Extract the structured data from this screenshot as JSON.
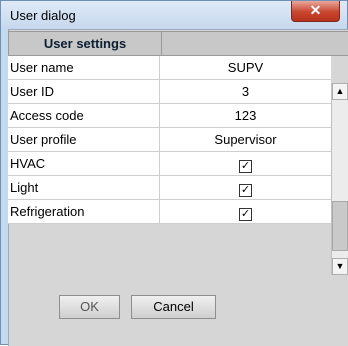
{
  "window": {
    "title": "User dialog",
    "close_icon": "✕"
  },
  "grid": {
    "header": "User settings",
    "rows": [
      {
        "label": "User name",
        "value": "SUPV"
      },
      {
        "label": "User ID",
        "value": "3"
      },
      {
        "label": "Access code",
        "value": "123"
      },
      {
        "label": "User profile",
        "value": "Supervisor"
      },
      {
        "label": "HVAC",
        "checked": true
      },
      {
        "label": "Light",
        "checked": true
      },
      {
        "label": "Refrigeration",
        "checked": true
      }
    ],
    "check_glyph": "✓"
  },
  "scrollbar": {
    "up_glyph": "▲",
    "down_glyph": "▼"
  },
  "buttons": {
    "ok": "OK",
    "cancel": "Cancel"
  }
}
